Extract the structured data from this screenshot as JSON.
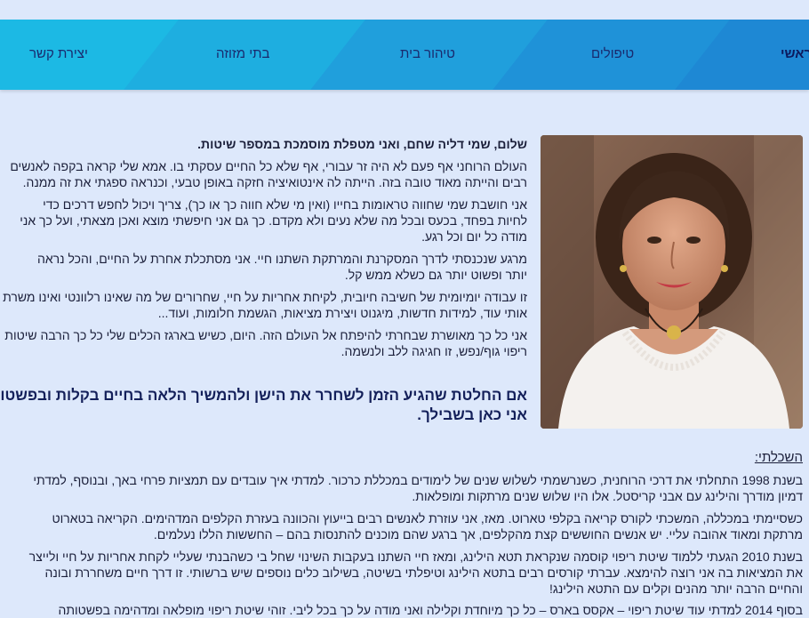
{
  "nav": {
    "items": [
      "יצירת קשר",
      "בתי מזוזה",
      "טיהור בית",
      "טיפולים",
      "ראשי"
    ]
  },
  "intro": {
    "greeting": "שלום, שמי דליה שחם, ואני מטפלת מוסמכת במספר שיטות.",
    "p1_l1": "העולם הרוחני אף פעם לא היה זר עבורי, אף שלא כל החיים עסקתי בו. אמא שלי קראה בקפה לאנשים",
    "p1_l2": "רבים והייתה מאוד טובה בזה. הייתה לה אינטואיציה חזקה באופן טבעי, וכנראה ספגתי את זה ממנה.",
    "p2_l1": "אני חושבת שמי שחווה טראומות בחייו (ואין מי שלא חווה כך או כך), צריך ויכול לחפש דרכים כדי",
    "p2_l2": "לחיות בפחד, בכעס ובכל מה שלא נעים ולא מקדם. כך גם אני חיפשתי מוצא ואכן מצאתי, ועל כך אני",
    "p2_l3": "מודה כל יום וכל רגע.",
    "p3_l1": "מרגע שנכנסתי לדרך המסקרנת והמרתקת השתנו חיי. אני מסתכלת אחרת על החיים, והכל נראה",
    "p3_l2": "יותר ופשוט יותר גם כשלא ממש קל.",
    "p4_l1": "זו עבודה יומיומית של חשיבה חיובית, לקיחת אחריות על חיי, שחרורים של מה שאינו רלוונטי ואינו משרת",
    "p4_l2": "אותי עוד, למידות חדשות, מיגנוט ויצירת מציאות, הגשמת חלומות, ועוד...",
    "p5_l1": "אני כל כך מאושרת שבחרתי להיפתח אל העולם הזה. היום, כשיש בארגז הכלים שלי כל כך הרבה שיטות",
    "p5_l2": "ריפוי גוף/נפש, זו חגיגה ללב ולנשמה.",
    "headline_l1": "אם החלטת שהגיע הזמן לשחרר את הישן ולהמשיך הלאה בחיים בקלות ובפשטות,",
    "headline_l2": "אני כאן בשבילך."
  },
  "education": {
    "heading": "השכלתי:",
    "e1_l1": "בשנת 1998 התחלתי את דרכי הרוחנית, כשנרשמתי לשלוש שנים של לימודים במכללת כרכור. למדתי איך עובדים עם תמציות פרחי באך, ובנוסף, למדתי",
    "e1_l2": "דמיון מודרך והילינג עם אבני קריסטל. אלו היו שלוש שנים מרתקות ומופלאות.",
    "e2_l1": "כשסיימתי במכללה, המשכתי לקורס קריאה בקלפי טארוט. מאז, אני עוזרת לאנשים רבים בייעוץ והכוונה בעזרת הקלפים המדהימים. הקריאה בטארוט",
    "e2_l2": "מרתקת ומאוד אהובה עליי. יש אנשים החוששים קצת מהקלפים, אך ברגע שהם מוכנים להתנסות בהם – החששות הללו נעלמים.",
    "e3_l1": "בשנת 2010 הגעתי ללמוד שיטת ריפוי קוסמה שנקראת תטא הילינג, ומאז חיי השתנו בעקבות השינוי שחל בי כשהבנתי שעליי לקחת אחריות על חיי ולייצר",
    "e3_l2": "את המציאות בה אני רוצה להימצא. עברתי קורסים רבים בתטא הילינג וטיפלתי בשיטה, בשילוב כלים נוספים שיש ברשותי. זו דרך חיים משחררת ובונה",
    "e3_l3": "והחיים הרבה יותר מהנים וקלים עם התטא הילינג!",
    "e4_l1": "בסוף 2014 למדתי עוד שיטת ריפוי – אקסס בארס – כל כך מיוחדת וקלילה ואני מודה על כך בכל ליבי. זוהי שיטת ריפוי מופלאה ומדהימה בפשטותה"
  },
  "colors": {
    "page_bg": "#dde8fb",
    "nav_base": "#1fb3e2",
    "nav_text": "#1a2a6e"
  },
  "photo": {
    "subject": "portrait-photo"
  }
}
